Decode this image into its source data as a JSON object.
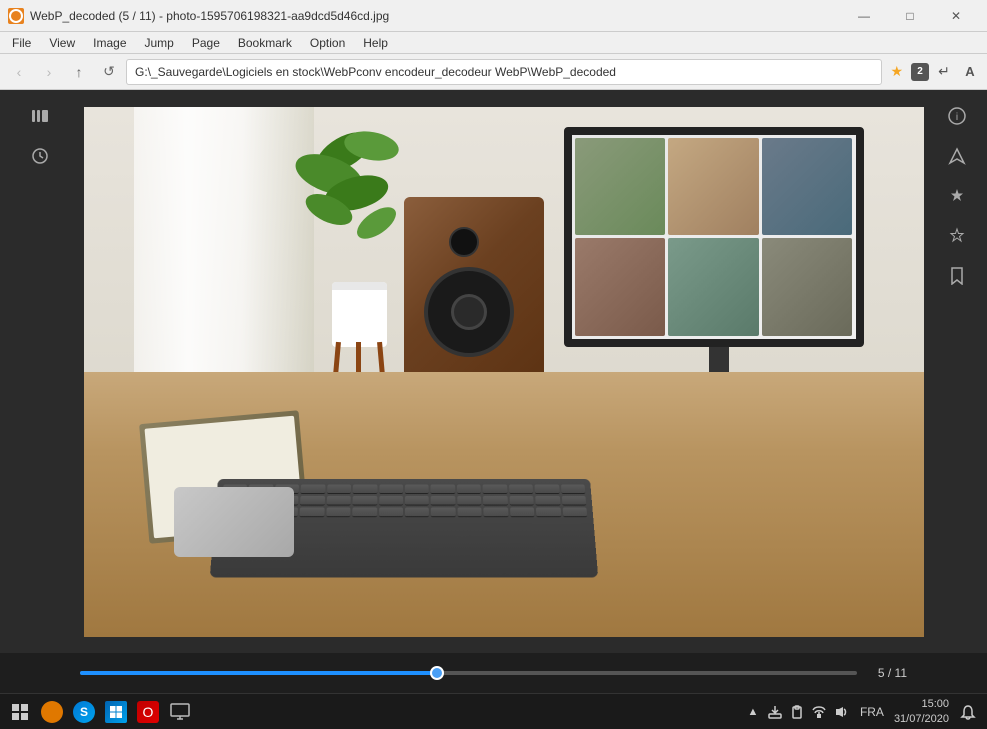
{
  "titleBar": {
    "appIcon": "sumatrapdf-icon",
    "title": "WebP_decoded (5 / 11) - photo-1595706198321-aa9dcd5d46cd.jpg",
    "minimizeLabel": "—",
    "maximizeLabel": "□",
    "closeLabel": "✕"
  },
  "menuBar": {
    "items": [
      {
        "id": "file",
        "label": "File"
      },
      {
        "id": "view",
        "label": "View"
      },
      {
        "id": "image",
        "label": "Image"
      },
      {
        "id": "jump",
        "label": "Jump"
      },
      {
        "id": "page",
        "label": "Page"
      },
      {
        "id": "bookmark",
        "label": "Bookmark"
      },
      {
        "id": "option",
        "label": "Option"
      },
      {
        "id": "help",
        "label": "Help"
      }
    ]
  },
  "addressBar": {
    "backLabel": "‹",
    "forwardLabel": "›",
    "upLabel": "↑",
    "refreshLabel": "↺",
    "address": "G:\\_Sauvegarde\\Logiciels en stock\\WebPconv encodeur_decodeur WebP\\WebP_decoded",
    "starLabel": "★",
    "badgeLabel": "2",
    "arrowLabel": "↵",
    "fontLabel": "A"
  },
  "sidebar": {
    "leftIcons": [
      {
        "id": "library",
        "icon": "📚"
      },
      {
        "id": "history",
        "icon": "🕐"
      }
    ],
    "rightIcons": [
      {
        "id": "info",
        "icon": "ℹ"
      },
      {
        "id": "navigate",
        "icon": "➤"
      },
      {
        "id": "tools",
        "icon": "✦"
      },
      {
        "id": "star",
        "icon": "★"
      },
      {
        "id": "bookmark",
        "icon": "🔖"
      }
    ]
  },
  "progressBar": {
    "current": 5,
    "total": 11,
    "label": "5 / 11",
    "percent": 46
  },
  "taskbar": {
    "leftIcons": [
      {
        "id": "start",
        "type": "grid",
        "label": "⊞"
      },
      {
        "id": "cortana",
        "type": "orange",
        "label": ""
      },
      {
        "id": "taskview",
        "type": "blue",
        "label": "S"
      },
      {
        "id": "windows",
        "type": "win",
        "label": "⊞"
      },
      {
        "id": "office",
        "type": "red",
        "label": "O"
      },
      {
        "id": "monitor",
        "type": "monitor",
        "label": "🖥"
      }
    ],
    "systemTray": {
      "icons": [
        "▲",
        "📤",
        "📋",
        "📶",
        "🔊"
      ],
      "language": "FRA",
      "time": "15:00",
      "date": "31/07/2020",
      "notification": "🔔"
    }
  }
}
